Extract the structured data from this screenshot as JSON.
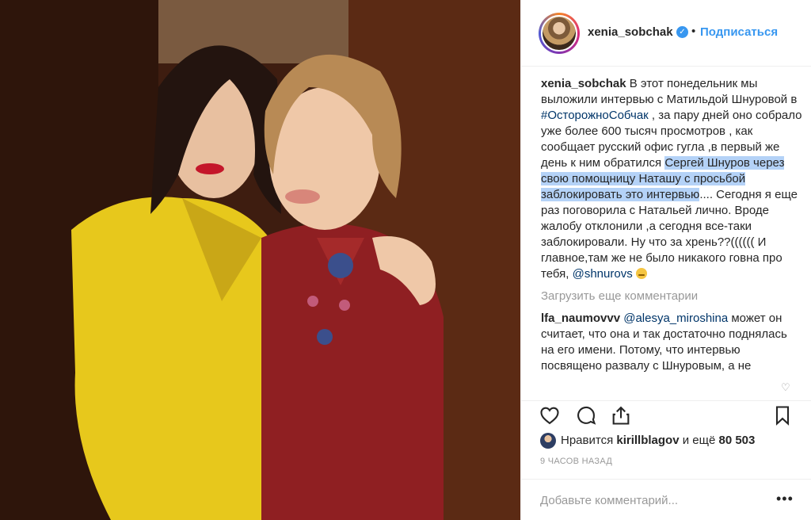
{
  "post": {
    "image_alt": "Two women posing together — one in a yellow dress, one in a red dress with floral embroidery",
    "author": "xenia_sobchak",
    "follow_label": "Подписаться",
    "separator": "•"
  },
  "caption": {
    "username": "xenia_sobchak",
    "text_1": " В этот понедельник мы выложили интервью с Матильдой Шнуровой в ",
    "hashtag": "#ОсторожноСобчак",
    "text_2": " , за пару дней оно собрало уже более 600 тысяч просмотров , как сообщает русский офис гугла ,в первый же день к ним обратился ",
    "highlight": "Сергей Шнуров через свою помощницу Наташу с просьбой заблокировать это интервью",
    "text_3": ".... Сегодня я еще раз поговорила с Натальей лично. Вроде жалобу отклонили ,а сегодня все-таки заблокировали. Ну что за хрень??(((((( И главное,там же не было никакого говна про тебя, ",
    "mention": "@shnurovs",
    "emoji": "grimacing-face"
  },
  "load_more": "Загрузить еще комментарии",
  "comment": {
    "username": "lfa_naumovvv",
    "mention": "@alesya_miroshina",
    "text": " может он считает, что она и так достаточно поднялась на его имени. Потому, что интервью посвящено развалу с Шнуровым, а не Матильде"
  },
  "likes": {
    "prefix": "Нравится ",
    "user": "kirillblagov",
    "suffix": " и ещё ",
    "count": "80 503"
  },
  "timestamp": "9 ЧАСОВ НАЗАД",
  "add_comment_placeholder": "Добавьте комментарий...",
  "more_label": "•••",
  "colors": {
    "link": "#3897f0",
    "hashtag": "#003569",
    "muted": "#999999",
    "highlight": "#b4d2f7"
  },
  "icons": [
    "heart-icon",
    "comment-icon",
    "share-icon",
    "bookmark-icon",
    "verified-icon",
    "more-options-icon"
  ]
}
